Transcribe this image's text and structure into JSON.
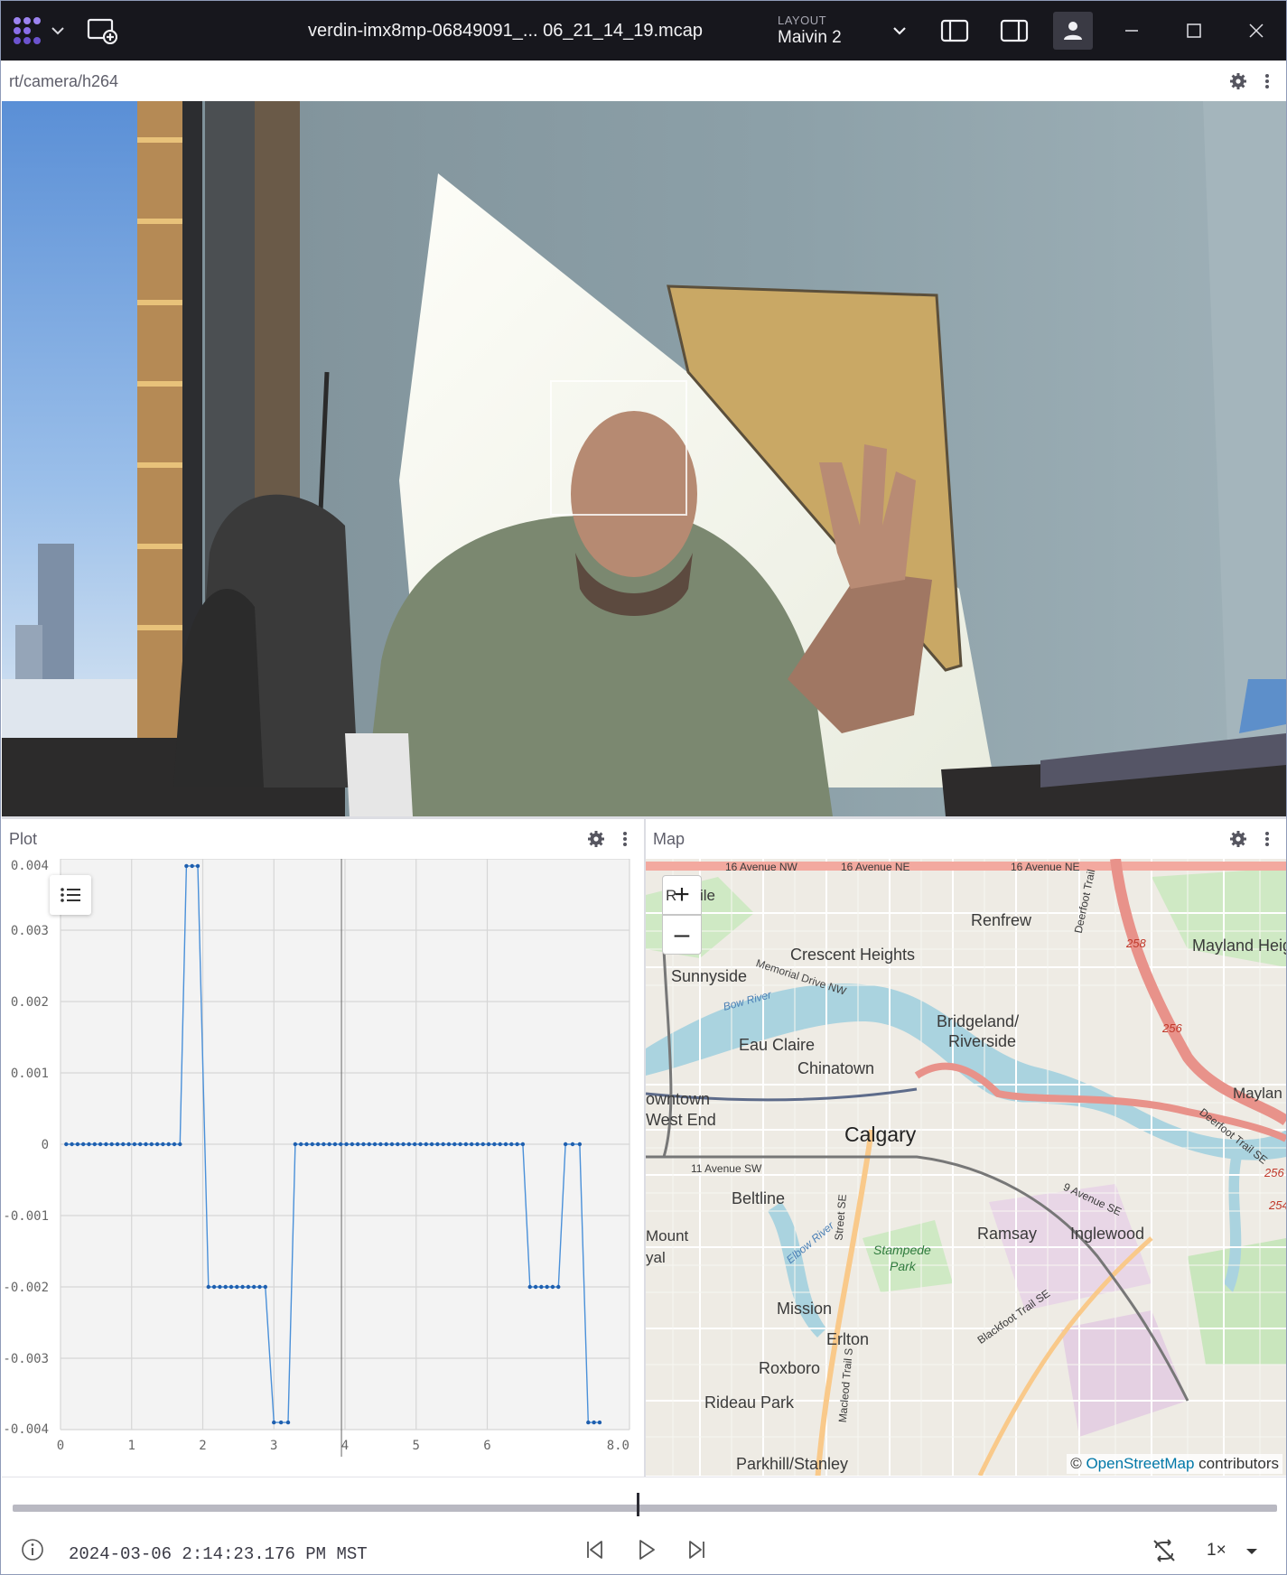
{
  "titlebar": {
    "file_title": "verdin-imx8mp-06849091_... 06_21_14_19.mcap",
    "layout_label": "LAYOUT",
    "layout_name": "Maivin 2",
    "icons": [
      "app-logo-icon",
      "chevron-down-icon",
      "add-panel-icon",
      "left-sidebar-icon",
      "right-sidebar-icon",
      "user-icon",
      "minimize-icon",
      "maximize-icon",
      "close-icon"
    ]
  },
  "camera_panel": {
    "topic": "rt/camera/h264",
    "icons": [
      "gear-icon",
      "more-vertical-icon"
    ]
  },
  "plot_panel": {
    "title": "Plot",
    "icons": [
      "gear-icon",
      "more-vertical-icon",
      "legend-list-icon"
    ]
  },
  "map_panel": {
    "title": "Map",
    "zoom_in": "+",
    "zoom_out": "–",
    "attribution_prefix": "© ",
    "attribution_link": "OpenStreetMap",
    "attribution_suffix": " contributors",
    "places": [
      "Renfrew",
      "Mayland Heigh",
      "Crescent Heights",
      "Sunnyside",
      "Memorial Drive NW",
      "Bow River",
      "Bridgeland/",
      "Riverside",
      "Eau Claire",
      "Chinatown",
      "owntown",
      "West End",
      "Calgary",
      "11 Avenue SW",
      "Beltline",
      "Mount",
      "yal",
      "Ramsay",
      "Inglewood",
      "9 Avenue SE",
      "Stampede",
      "Park",
      "Mission",
      "Erlton",
      "Roxboro",
      "Rideau Park",
      "Parkhill/Stanley",
      "16 Avenue NW",
      "16 Avenue NE",
      "Deerfoot Trail",
      "258",
      "256",
      "254",
      "Maylan",
      "Deerfoot Trail SE",
      "Blackfoot Trail SE",
      "Macleod Trail S",
      "Street SE",
      "Elbow River",
      "R",
      "ile"
    ]
  },
  "playback": {
    "timestamp": "2024-03-06 2:14:23.176 PM MST",
    "speed": "1×",
    "position_fraction": 0.494,
    "icons": [
      "info-icon",
      "skip-back-icon",
      "play-icon",
      "skip-forward-icon",
      "loop-off-icon",
      "chevron-down-icon"
    ]
  },
  "chart_data": {
    "type": "line",
    "title": "",
    "xlabel": "",
    "ylabel": "",
    "xlim": [
      0,
      8.0
    ],
    "ylim": [
      -0.004,
      0.004
    ],
    "x_ticks": [
      "0",
      "1",
      "2",
      "3",
      "4",
      "5",
      "6",
      "8.0"
    ],
    "y_ticks": [
      "0.004",
      "0.003",
      "0.002",
      "0.001",
      "0",
      "-0.001",
      "-0.002",
      "-0.003",
      "-0.004"
    ],
    "grid": true,
    "series": [
      {
        "color": "#4a90d9",
        "x": [
          0.08,
          0.16,
          0.24,
          0.32,
          0.4,
          0.48,
          0.56,
          0.64,
          0.72,
          0.8,
          0.88,
          0.96,
          1.04,
          1.12,
          1.2,
          1.28,
          1.36,
          1.44,
          1.52,
          1.6,
          1.68,
          1.77,
          1.85,
          1.93,
          2.08,
          2.16,
          2.24,
          2.32,
          2.4,
          2.48,
          2.56,
          2.64,
          2.72,
          2.8,
          2.88,
          3.0,
          3.1,
          3.2,
          3.3,
          3.38,
          3.46,
          3.54,
          3.62,
          3.7,
          3.78,
          3.86,
          3.94,
          4.02,
          4.1,
          4.18,
          4.26,
          4.34,
          4.42,
          4.5,
          4.58,
          4.66,
          4.74,
          4.82,
          4.9,
          4.98,
          5.06,
          5.14,
          5.22,
          5.3,
          5.38,
          5.46,
          5.54,
          5.62,
          5.7,
          5.78,
          5.86,
          5.94,
          6.02,
          6.1,
          6.18,
          6.26,
          6.34,
          6.42,
          6.5,
          6.6,
          6.68,
          6.76,
          6.84,
          6.92,
          7.0,
          7.1,
          7.2,
          7.3,
          7.42,
          7.5,
          7.58
        ],
        "y": [
          0,
          0,
          0,
          0,
          0,
          0,
          0,
          0,
          0,
          0,
          0,
          0,
          0,
          0,
          0,
          0,
          0,
          0,
          0,
          0,
          0,
          0.0039,
          0.0039,
          0.0039,
          -0.002,
          -0.002,
          -0.002,
          -0.002,
          -0.002,
          -0.002,
          -0.002,
          -0.002,
          -0.002,
          -0.002,
          -0.002,
          -0.0039,
          -0.0039,
          -0.0039,
          0,
          0,
          0,
          0,
          0,
          0,
          0,
          0,
          0,
          0,
          0,
          0,
          0,
          0,
          0,
          0,
          0,
          0,
          0,
          0,
          0,
          0,
          0,
          0,
          0,
          0,
          0,
          0,
          0,
          0,
          0,
          0,
          0,
          0,
          0,
          0,
          0,
          0,
          0,
          0,
          0,
          -0.002,
          -0.002,
          -0.002,
          -0.002,
          -0.002,
          -0.002,
          0,
          0,
          0,
          -0.0039,
          -0.0039,
          -0.0039
        ]
      }
    ],
    "cursor_x": 3.95
  }
}
